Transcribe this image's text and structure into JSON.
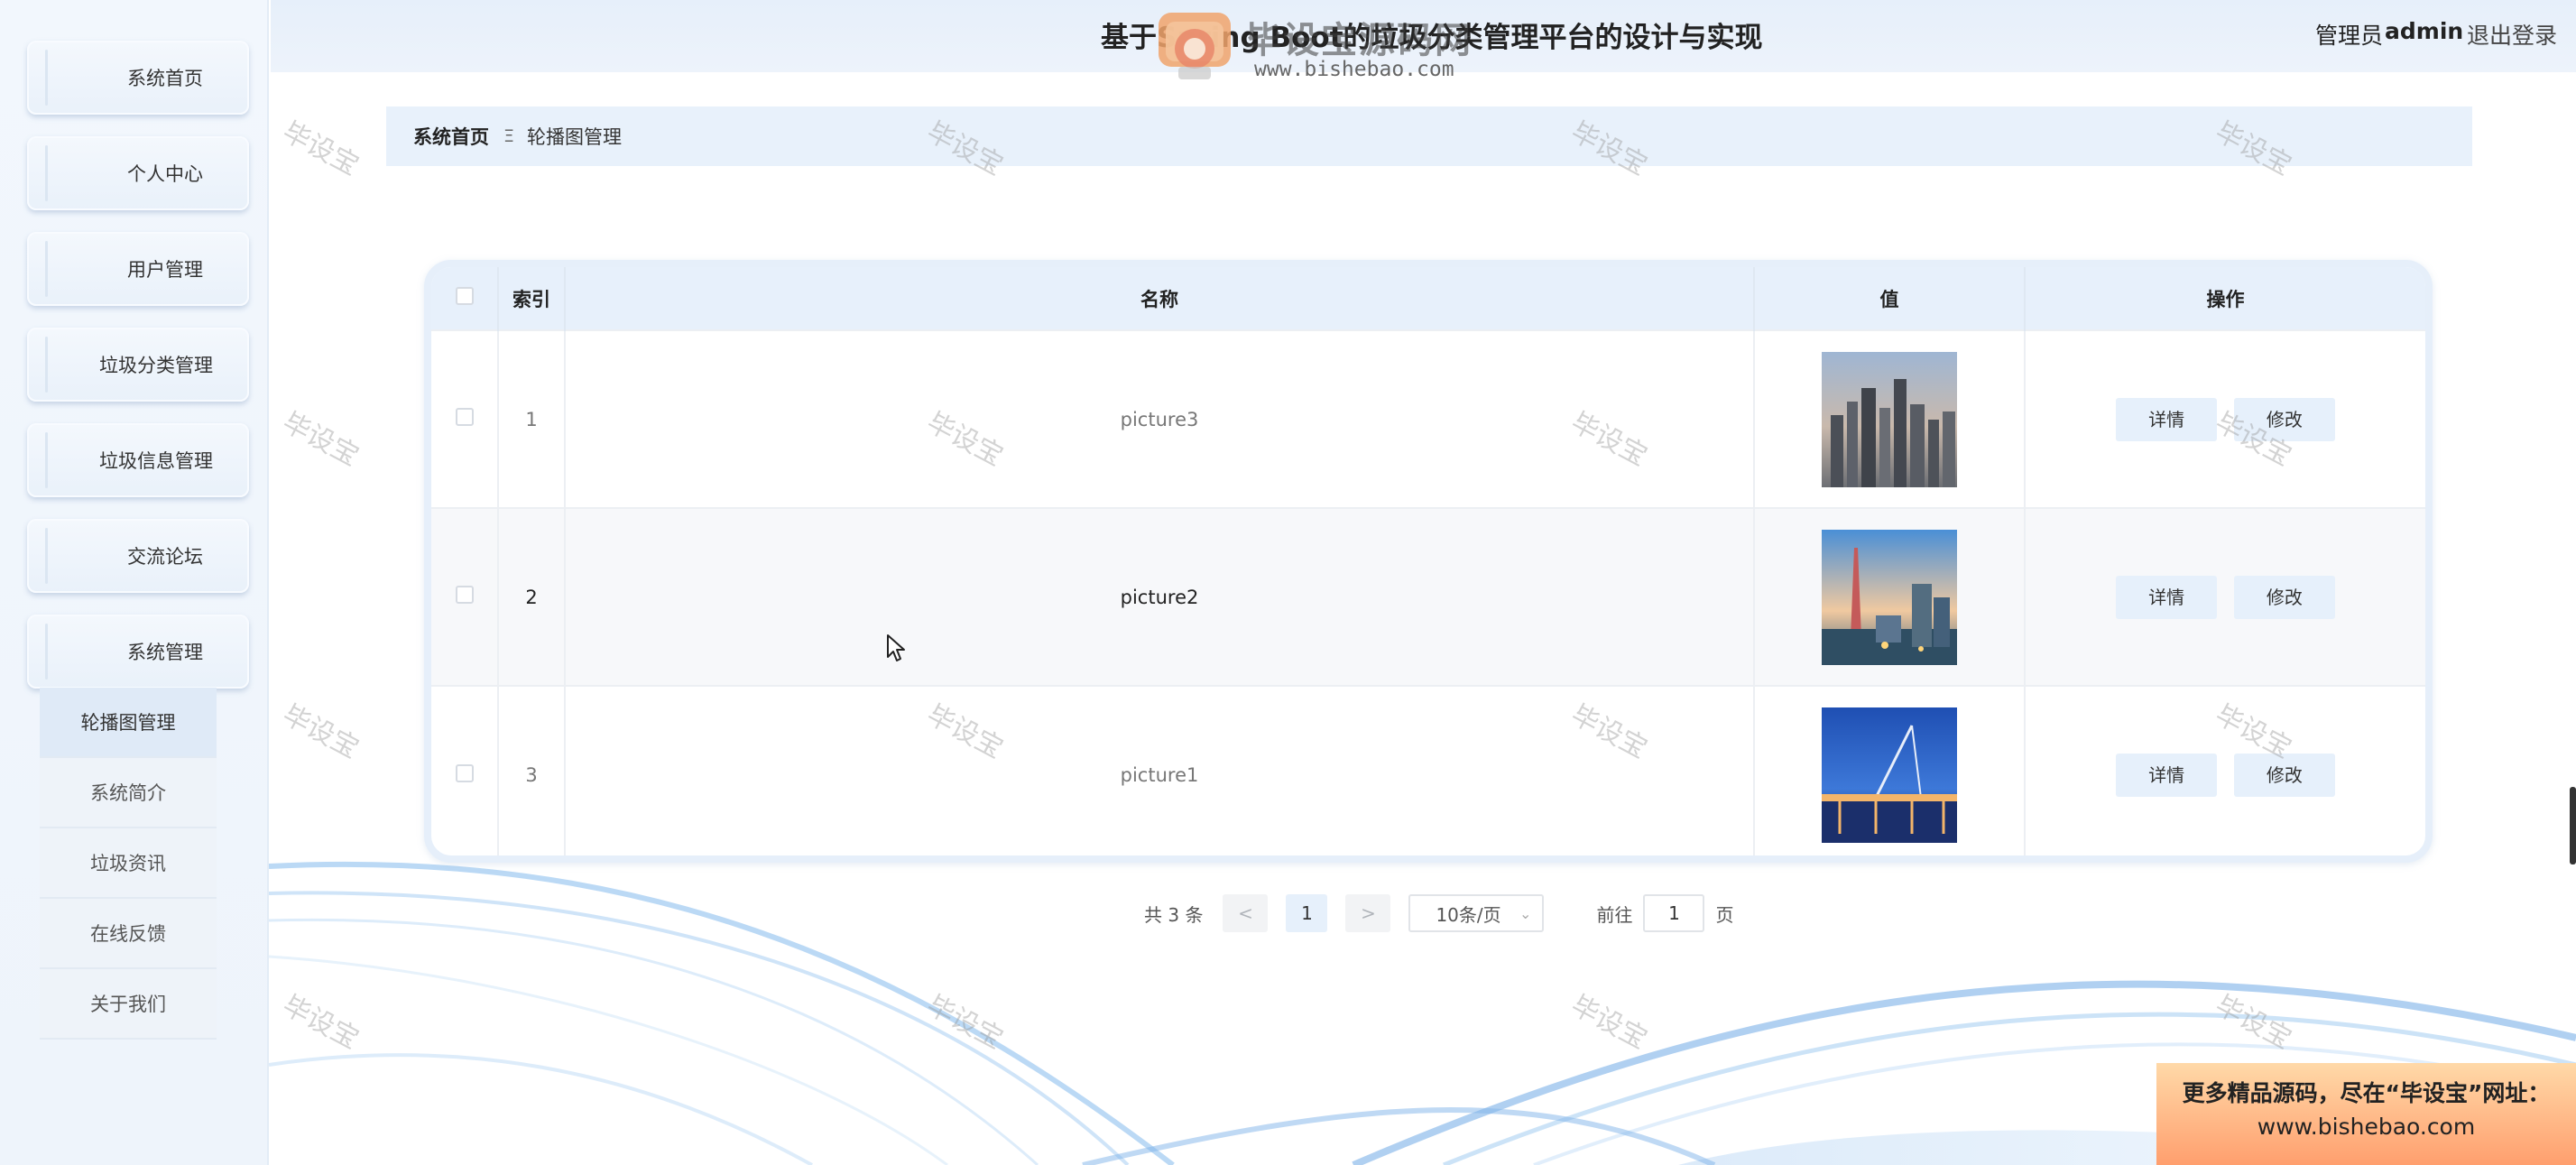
{
  "header": {
    "title": "基于Spring Boot的垃圾分类管理平台的设计与实现",
    "user_role": "管理员",
    "user_name": "admin",
    "logout": "退出登录"
  },
  "logo": {
    "text": "毕设宝源码网",
    "url": "www.bishebao.com"
  },
  "sidebar": {
    "items": [
      {
        "label": "系统首页"
      },
      {
        "label": "个人中心"
      },
      {
        "label": "用户管理"
      },
      {
        "label": "垃圾分类管理"
      },
      {
        "label": "垃圾信息管理"
      },
      {
        "label": "交流论坛"
      },
      {
        "label": "系统管理"
      }
    ],
    "sub_items": [
      {
        "label": "轮播图管理"
      },
      {
        "label": "系统简介"
      },
      {
        "label": "垃圾资讯"
      },
      {
        "label": "在线反馈"
      },
      {
        "label": "关于我们"
      }
    ]
  },
  "breadcrumb": {
    "home": "系统首页",
    "separator": "Ξ",
    "current": "轮播图管理"
  },
  "table": {
    "headers": {
      "index": "索引",
      "name": "名称",
      "value": "值",
      "action": "操作"
    },
    "rows": [
      {
        "index": "1",
        "name": "picture3",
        "image": "city-skyline-image"
      },
      {
        "index": "2",
        "name": "picture2",
        "image": "tower-city-image"
      },
      {
        "index": "3",
        "name": "picture1",
        "image": "bridge-night-image"
      }
    ],
    "detail_label": "详情",
    "edit_label": "修改"
  },
  "pagination": {
    "total": "共 3 条",
    "prev": "<",
    "current": "1",
    "next": ">",
    "page_size": "10条/页",
    "goto_prefix": "前往",
    "goto_value": "1",
    "goto_suffix": "页"
  },
  "watermark": "毕设宝",
  "promo": {
    "line1": "更多精品源码，尽在“毕设宝”网址：",
    "line2": "www.bishebao.com"
  },
  "colors": {
    "accent": "#e6f0fb",
    "header_bg": "#e6effa",
    "promo_top": "#ffd9a8",
    "promo_bottom": "#ff9f6e"
  }
}
